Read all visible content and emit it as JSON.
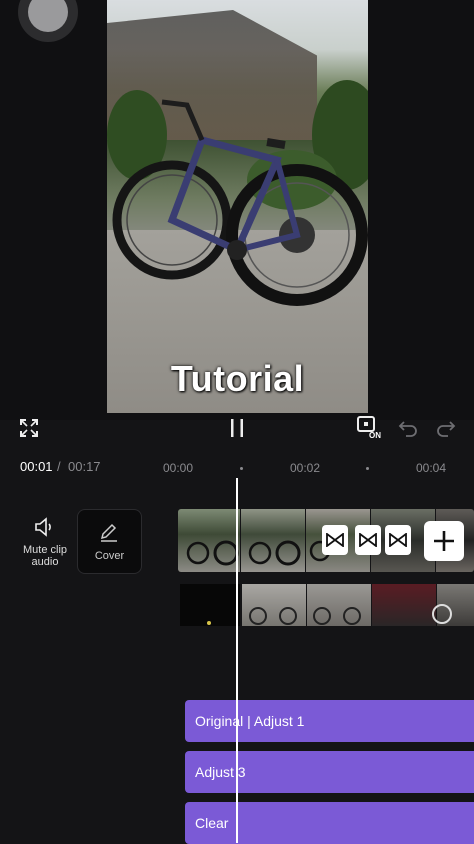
{
  "preview": {
    "title_text": "Tutorial"
  },
  "controls": {
    "fullscreen_icon": "fullscreen-icon",
    "pause_icon": "pause-icon",
    "keyframe_icon": "keyframe-on-icon",
    "keyframe_badge": "ON",
    "undo_icon": "undo-icon",
    "redo_icon": "redo-icon"
  },
  "timeline": {
    "current_time": "00:01",
    "separator": "/",
    "total_time": "00:17",
    "ticks": [
      "00:00",
      "00:02",
      "00:04"
    ]
  },
  "tools": {
    "mute_label_line1": "Mute clip",
    "mute_label_line2": "audio",
    "cover_label": "Cover"
  },
  "effects": [
    {
      "label": "Original | Adjust 1"
    },
    {
      "label": "Adjust 3"
    },
    {
      "label": "Clear"
    }
  ],
  "colors": {
    "accent_purple": "#7b5ad6",
    "background": "#141416"
  }
}
